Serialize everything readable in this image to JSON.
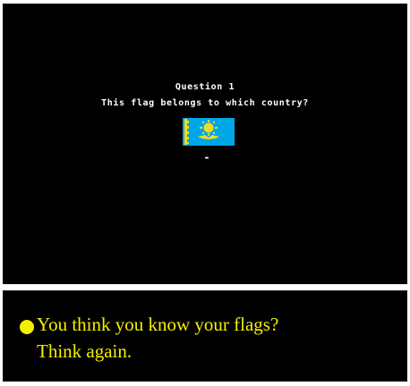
{
  "game": {
    "question_title": "Question 1",
    "question_text": "This flag belongs to which country?",
    "input_cursor": "-",
    "flag_icon": "kazakhstan-flag-icon",
    "colors": {
      "screen_bg": "#000000",
      "text": "#ffffff",
      "flag_blue": "#00a7e6",
      "flag_gold": "#f2dc1a"
    }
  },
  "caption": {
    "line1": "You think you know your flags?",
    "line2": "Think again.",
    "bullet_icon": "yellow-dot-icon",
    "color": "#f5f000"
  }
}
